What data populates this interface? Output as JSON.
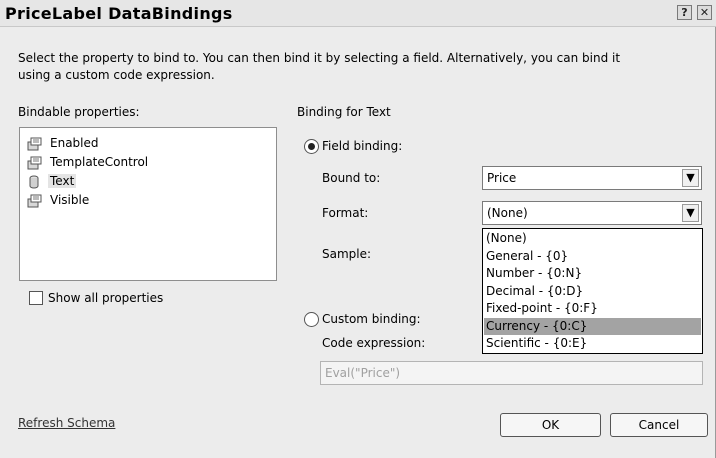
{
  "window": {
    "title": "PriceLabel DataBindings",
    "help_btn": "?",
    "close_btn": "✕"
  },
  "instruction": {
    "line1": "Select the property to bind to. You can then bind it by selecting a field. Alternatively, you can bind it",
    "line2": "using a custom code expression."
  },
  "properties": {
    "header": "Bindable properties:",
    "items": [
      {
        "label": "Enabled",
        "icon": "property-icon"
      },
      {
        "label": "TemplateControl",
        "icon": "property-icon"
      },
      {
        "label": "Text",
        "icon": "database-icon",
        "selected": true
      },
      {
        "label": "Visible",
        "icon": "property-icon"
      }
    ],
    "show_all_label": "Show all properties",
    "show_all_checked": false
  },
  "binding": {
    "header": "Binding for Text",
    "field_binding_label": "Field binding:",
    "field_binding_selected": true,
    "bound_to_label": "Bound to:",
    "bound_to_value": "Price",
    "format_label": "Format:",
    "format_value": "(None)",
    "format_options": [
      "(None)",
      "General - {0}",
      "Number - {0:N}",
      "Decimal - {0:D}",
      "Fixed-point - {0:F}",
      "Currency - {0:C}",
      "Scientific - {0:E}"
    ],
    "format_highlighted": "Currency - {0:C}",
    "sample_label": "Sample:",
    "custom_binding_label": "Custom binding:",
    "code_expression_label": "Code expression:",
    "code_expression_value": "Eval(\"Price\")"
  },
  "footer": {
    "refresh_link": "Refresh Schema",
    "ok_label": "OK",
    "cancel_label": "Cancel"
  }
}
